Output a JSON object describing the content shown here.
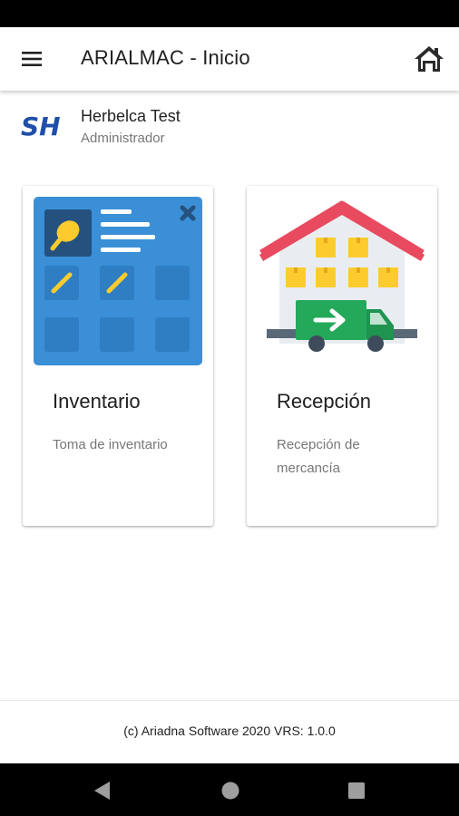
{
  "app_bar": {
    "title": "ARIALMAC - Inicio",
    "menu_icon": "hamburger-menu-icon",
    "home_icon": "home-icon"
  },
  "user": {
    "logo_text": "SH",
    "name": "Herbelca Test",
    "role": "Administrador"
  },
  "cards": [
    {
      "title": "Inventario",
      "description": "Toma de inventario",
      "icon": "inventory-board-icon"
    },
    {
      "title": "Recepción",
      "description": "Recepción de mercancía",
      "icon": "warehouse-delivery-truck-icon"
    }
  ],
  "footer": {
    "text": "(c) Ariadna Software 2020 VRS: 1.0.0"
  },
  "colors": {
    "inventory_blue": "#3a8fd6",
    "inventory_tile": "#2f7ec4",
    "inventory_dark": "#24517e",
    "accent_yellow": "#fccc2e",
    "roof_red": "#e84a5f",
    "truck_green": "#24a85a",
    "wheel_dark": "#3e4b5a"
  },
  "system_nav": {
    "back_icon": "back-triangle-icon",
    "home_icon": "home-circle-icon",
    "recents_icon": "recents-square-icon"
  }
}
